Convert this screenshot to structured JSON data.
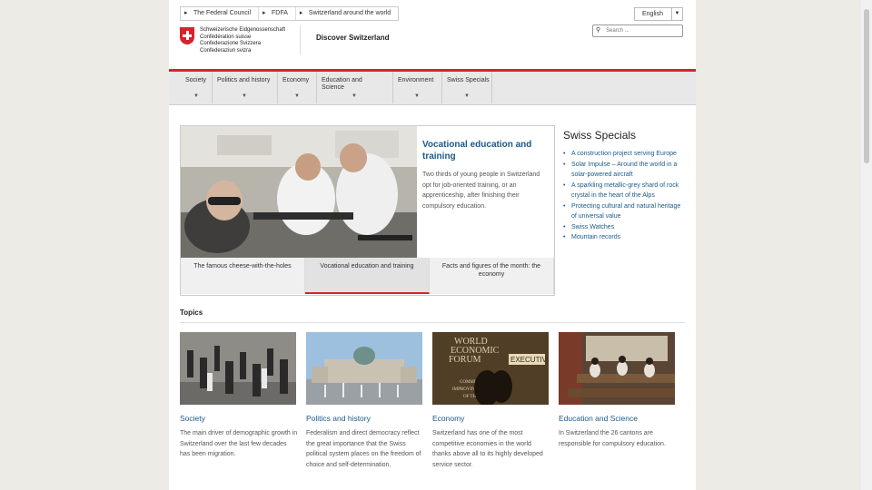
{
  "breadcrumb": [
    "The Federal Council",
    "FDFA",
    "Switzerland around the world"
  ],
  "language": "English",
  "logo_lines": [
    "Schweizerische Eidgenossenschaft",
    "Confédération suisse",
    "Confederazione Svizzera",
    "Confederaziun svizra"
  ],
  "site_title": "Discover Switzerland",
  "search_placeholder": "Search ...",
  "nav": [
    {
      "label": "Society"
    },
    {
      "label": "Politics and history"
    },
    {
      "label": "Economy"
    },
    {
      "label": "Education and Science"
    },
    {
      "label": "Environment"
    },
    {
      "label": "Swiss Specials"
    }
  ],
  "hero": {
    "title": "Vocational education and training",
    "description": "Two thirds of young people in Switzerland opt for job-oriented training, or an apprenticeship, after finishing their compulsory education.",
    "tabs": [
      "The famous cheese-with-the-holes",
      "Vocational education and training",
      "Facts and figures of the month: the economy"
    ]
  },
  "specials": {
    "title": "Swiss Specials",
    "items": [
      "A construction project serving Europe",
      "Solar Impulse – Around the world in a solar-powered aircraft",
      "A sparkling metallic-grey shard of rock crystal in the heart of the Alps",
      "Protecting cultural and natural heritage of universal value",
      "Swiss Watches",
      "Mountain records"
    ]
  },
  "topics": {
    "title": "Topics",
    "items": [
      {
        "title": "Society",
        "description": "The main driver of demographic growth in Switzerland over the last few decades has been migration."
      },
      {
        "title": "Politics and history",
        "description": "Federalism and direct democracy reflect the great importance that the Swiss political system places on the freedom of choice and self-determination."
      },
      {
        "title": "Economy",
        "description": "Switzerland has one of the most competitive economies in the world thanks above all to its highly developed service sector."
      },
      {
        "title": "Education and Science",
        "description": "In Switzerland the 26 cantons are responsible for compulsory education."
      }
    ],
    "wef_sign_lines": [
      "WORLD",
      "ECONOMIC",
      "FORUM",
      "COMMITTED TO",
      "IMPROVING THE STATE",
      "OF THE WORLD"
    ],
    "wef_executive": "EXECUTIVE"
  },
  "colors": {
    "accent_red": "#d8232a",
    "link_blue": "#1a5a8a",
    "nav_bg": "#e8e8e8"
  },
  "icons": {
    "search": "search-icon",
    "swiss_cross": "swiss-cross-icon"
  }
}
